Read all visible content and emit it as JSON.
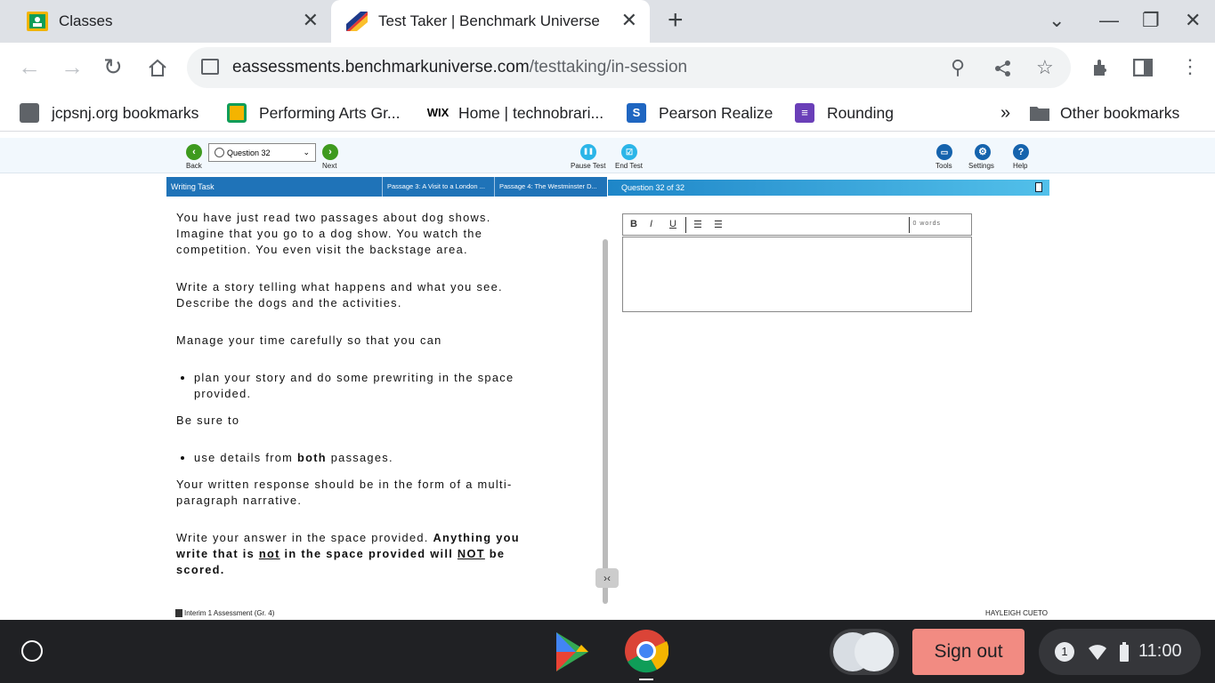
{
  "browser": {
    "tabs": [
      {
        "title": "Classes",
        "active": false
      },
      {
        "title": "Test Taker | Benchmark Universe",
        "active": true
      }
    ],
    "url_domain": "eassessments.benchmarkuniverse.com",
    "url_path": "/testtaking/in-session",
    "bookmarks": [
      {
        "label": "jcpsnj.org bookmarks",
        "icon": "building-icon"
      },
      {
        "label": "Performing Arts Gr...",
        "icon": "google-classroom-icon"
      },
      {
        "label": "Home | technobrari...",
        "icon": "wix-icon"
      },
      {
        "label": "Pearson Realize",
        "icon": "pearson-icon"
      },
      {
        "label": "Rounding",
        "icon": "list-icon"
      }
    ],
    "bookmarks_overflow": "»",
    "other_bookmarks": "Other bookmarks"
  },
  "test": {
    "back_label": "Back",
    "next_label": "Next",
    "question_select": "Question 32",
    "pause_label": "Pause Test",
    "end_label": "End Test",
    "tools_label": "Tools",
    "settings_label": "Settings",
    "help_label": "Help",
    "passage_tabs": [
      "Writing Task",
      "Passage 3: A Visit to a London ...",
      "Passage 4: The Westminster D..."
    ],
    "question_header": "Question 32 of 32",
    "word_count": "0 words",
    "prompt": {
      "p1": "You have just read two passages about dog shows. Imagine that you go to a dog show. You watch the competition. You even visit the backstage area.",
      "p2": "Write a story telling what happens and what you see. Describe the dogs and the activities.",
      "p3": "Manage your time carefully so that you can",
      "bullet1": "plan your story and do some prewriting in the space provided.",
      "p4": "Be sure to",
      "bullet2_pre": "use details from ",
      "bullet2_bold": "both",
      "bullet2_post": " passages.",
      "p5": "Your written response should be in the form of a multi-paragraph narrative.",
      "p6_pre": "Write your answer in the space provided. ",
      "p6_bold1": "Anything you write that is ",
      "p6_not1": "not",
      "p6_bold2": " in the space provided will ",
      "p6_not2": "NOT",
      "p6_bold3": " be scored."
    },
    "footer_left": "Interim 1 Assessment (Gr. 4)",
    "footer_right": "HAYLEIGH CUETO"
  },
  "shelf": {
    "sign_out": "Sign out",
    "notification_count": "1",
    "time": "11:00"
  },
  "colors": {
    "accent_blue": "#1f73b8",
    "nav_green": "#3e9a1e",
    "sign_out_bg": "#f28b82"
  }
}
